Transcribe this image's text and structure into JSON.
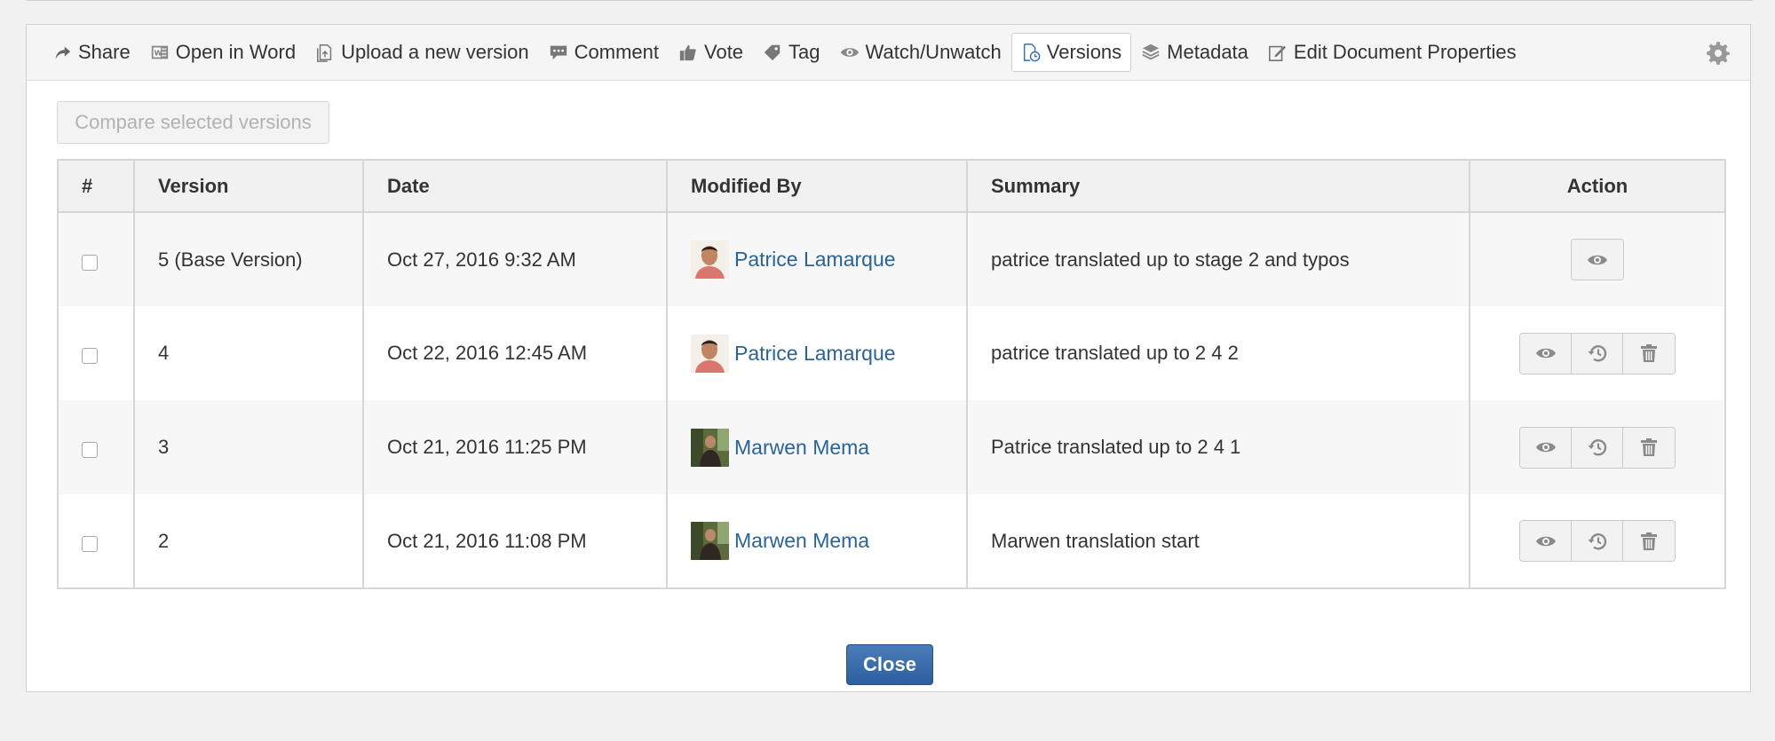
{
  "toolbar": {
    "items": [
      {
        "label": "Share",
        "icon": "share-icon"
      },
      {
        "label": "Open in Word",
        "icon": "word-icon"
      },
      {
        "label": "Upload a new version",
        "icon": "upload-version-icon"
      },
      {
        "label": "Comment",
        "icon": "comment-icon"
      },
      {
        "label": "Vote",
        "icon": "thumbs-up-icon"
      },
      {
        "label": "Tag",
        "icon": "tag-icon"
      },
      {
        "label": "Watch/Unwatch",
        "icon": "eye-icon"
      },
      {
        "label": "Versions",
        "icon": "versions-icon",
        "active": true
      },
      {
        "label": "Metadata",
        "icon": "metadata-icon"
      },
      {
        "label": "Edit Document Properties",
        "icon": "edit-icon"
      }
    ],
    "settings_icon": "gear-icon"
  },
  "compare_button": "Compare selected versions",
  "table": {
    "headers": [
      "#",
      "Version",
      "Date",
      "Modified By",
      "Summary",
      "Action"
    ],
    "rows": [
      {
        "version": "5 (Base Version)",
        "date": "Oct 27, 2016 9:32 AM",
        "user": "Patrice Lamarque",
        "summary": "patrice translated up to stage 2 and typos",
        "actions": [
          "view"
        ]
      },
      {
        "version": "4",
        "date": "Oct 22, 2016 12:45 AM",
        "user": "Patrice Lamarque",
        "summary": "patrice translated up to 2 4 2",
        "actions": [
          "view",
          "restore",
          "delete"
        ]
      },
      {
        "version": "3",
        "date": "Oct 21, 2016 11:25 PM",
        "user": "Marwen Mema",
        "summary": "Patrice translated up to 2 4 1",
        "actions": [
          "view",
          "restore",
          "delete"
        ]
      },
      {
        "version": "2",
        "date": "Oct 21, 2016 11:08 PM",
        "user": "Marwen Mema",
        "summary": "Marwen translation start",
        "actions": [
          "view",
          "restore",
          "delete"
        ]
      }
    ]
  },
  "close_button": "Close",
  "colors": {
    "link": "#2a6496",
    "primary": "#2d5f9e",
    "toolbar_bg": "#f5f5f5"
  }
}
